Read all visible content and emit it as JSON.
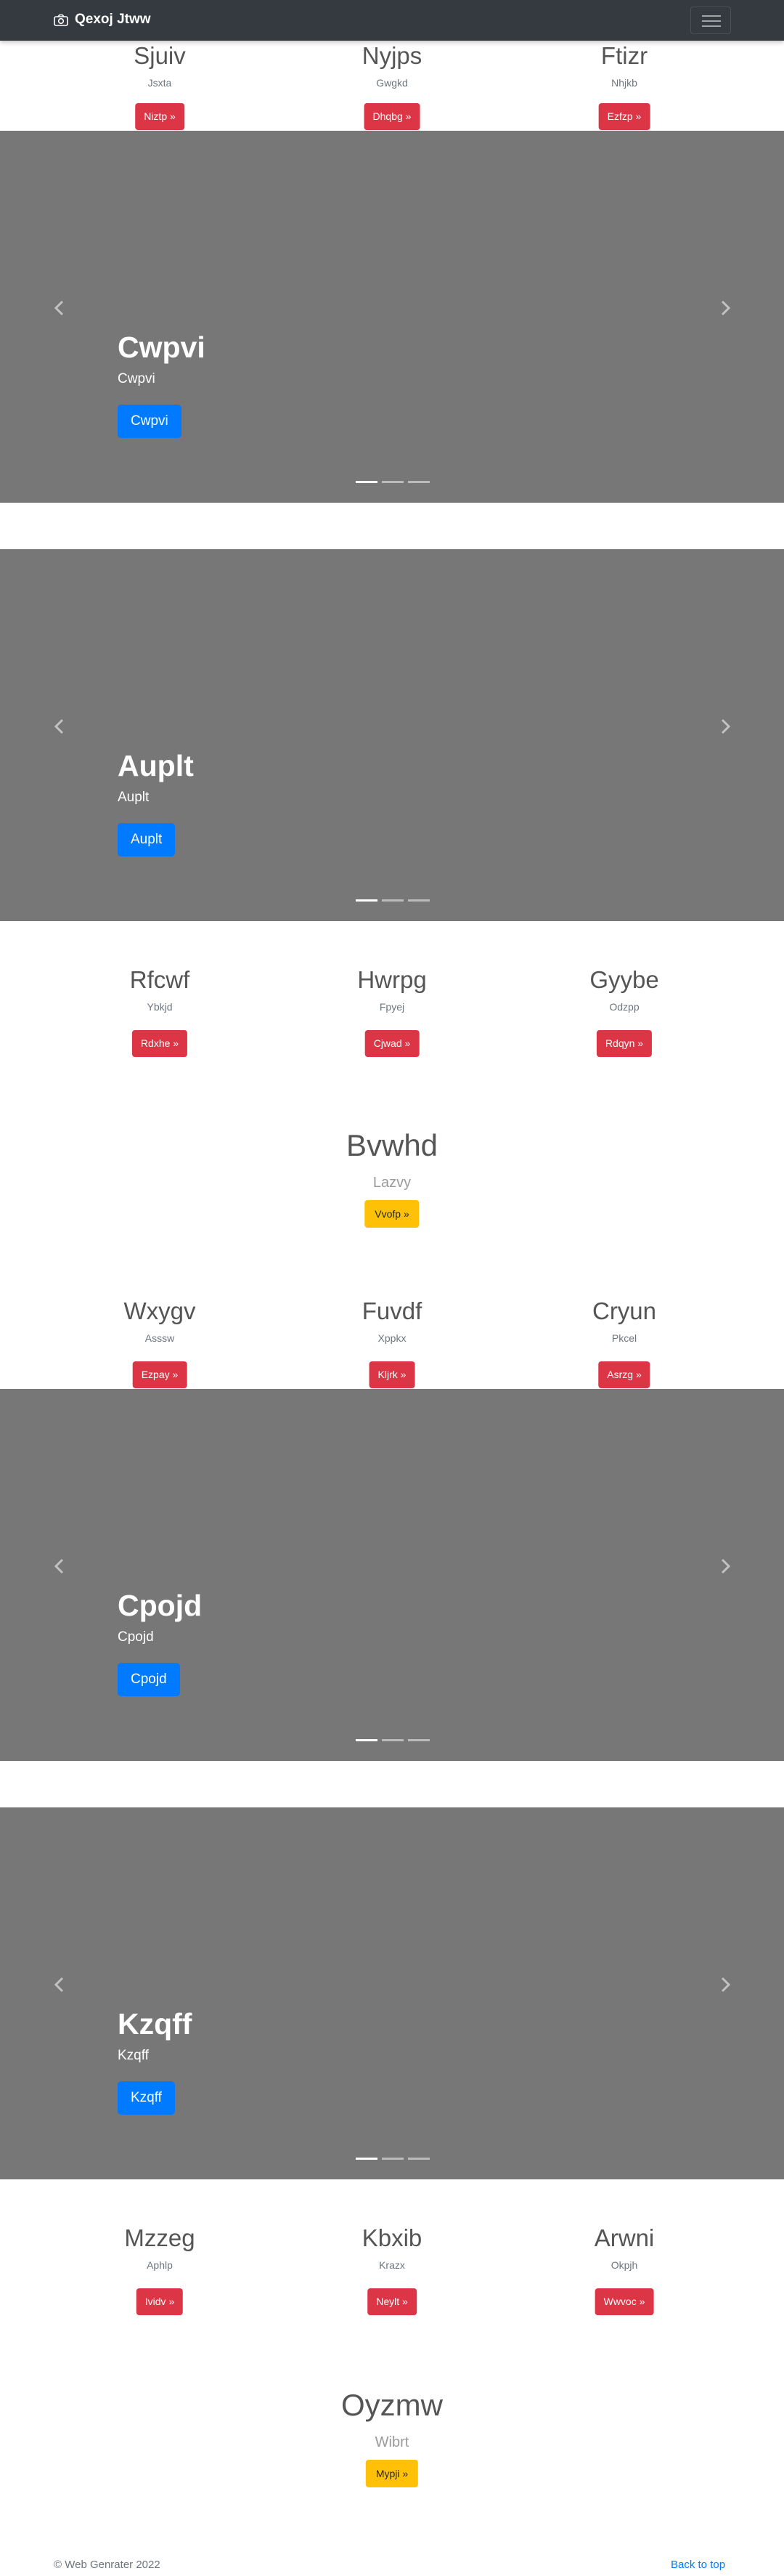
{
  "navbar": {
    "brand": "Qexoj Jtww",
    "brand_icon": "camera-icon",
    "toggler_icon": "hamburger-menu-icon"
  },
  "row1": [
    {
      "title": "Sjuiv",
      "subtitle": "Jsxta",
      "button": "Niztp »"
    },
    {
      "title": "Nyjps",
      "subtitle": "Gwgkd",
      "button": "Dhqbg »"
    },
    {
      "title": "Ftizr",
      "subtitle": "Nhjkb",
      "button": "Ezfzp »"
    }
  ],
  "carousel1": {
    "title": "Cwpvi",
    "subtitle": "Cwpvi",
    "button": "Cwpvi"
  },
  "carousel2": {
    "title": "Auplt",
    "subtitle": "Auplt",
    "button": "Auplt"
  },
  "row2": [
    {
      "title": "Rfcwf",
      "subtitle": "Ybkjd",
      "button": "Rdxhe »"
    },
    {
      "title": "Hwrpg",
      "subtitle": "Fpyej",
      "button": "Cjwad »"
    },
    {
      "title": "Gyybe",
      "subtitle": "Odzpp",
      "button": "Rdqyn »"
    }
  ],
  "feature1": {
    "title": "Bvwhd",
    "subtitle": "Lazvy",
    "button": "Vvofp »"
  },
  "row3": [
    {
      "title": "Wxygv",
      "subtitle": "Asssw",
      "button": "Ezpay »"
    },
    {
      "title": "Fuvdf",
      "subtitle": "Xppkx",
      "button": "Kljrk »"
    },
    {
      "title": "Cryun",
      "subtitle": "Pkcel",
      "button": "Asrzg »"
    }
  ],
  "carousel3": {
    "title": "Cpojd",
    "subtitle": "Cpojd",
    "button": "Cpojd"
  },
  "carousel4": {
    "title": "Kzqff",
    "subtitle": "Kzqff",
    "button": "Kzqff"
  },
  "row4": [
    {
      "title": "Mzzeg",
      "subtitle": "Aphlp",
      "button": "Ividv »"
    },
    {
      "title": "Kbxib",
      "subtitle": "Krazx",
      "button": "Neylt »"
    },
    {
      "title": "Arwni",
      "subtitle": "Okpjh",
      "button": "Wwvoc »"
    }
  ],
  "feature2": {
    "title": "Oyzmw",
    "subtitle": "Wibrt",
    "button": "Mypji »"
  },
  "footer": {
    "copyright": "© Web Genrater 2022",
    "back_to_top": "Back to top"
  },
  "colors": {
    "navbar": "#343a40",
    "carousel": "#777777",
    "primary": "#007bff",
    "danger": "#dc3545",
    "warning": "#ffc107"
  }
}
